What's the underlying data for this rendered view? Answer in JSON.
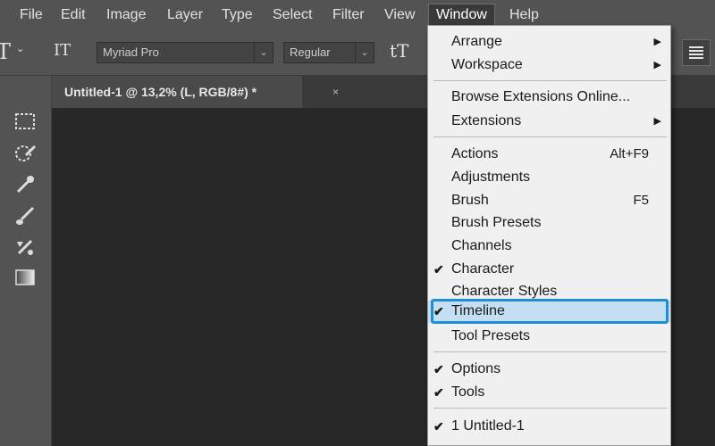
{
  "menubar": {
    "items": [
      "File",
      "Edit",
      "Image",
      "Layer",
      "Type",
      "Select",
      "Filter",
      "View",
      "Window",
      "Help"
    ],
    "active": "Window"
  },
  "optionsbar": {
    "font_family": "Myriad Pro",
    "font_style": "Regular",
    "tool_glyph": "T",
    "orient_glyph": "IT",
    "size_glyph": "tT"
  },
  "document": {
    "tab_title": "Untitled-1 @ 13,2% (L, RGB/8#) *",
    "close_glyph": "×"
  },
  "window_menu": {
    "items": [
      {
        "label": "Arrange",
        "submenu": true
      },
      {
        "label": "Workspace",
        "submenu": true
      },
      {
        "label": "Browse Extensions Online..."
      },
      {
        "label": "Extensions",
        "submenu": true
      },
      {
        "label": "Actions",
        "shortcut": "Alt+F9"
      },
      {
        "label": "Adjustments"
      },
      {
        "label": "Brush",
        "shortcut": "F5"
      },
      {
        "label": "Brush Presets"
      },
      {
        "label": "Channels"
      },
      {
        "label": "Character",
        "checked": true
      },
      {
        "label": "Character Styles"
      },
      {
        "label": "Timeline",
        "checked": true,
        "highlighted": true
      },
      {
        "label": "Tool Presets"
      },
      {
        "label": "Options",
        "checked": true
      },
      {
        "label": "Tools",
        "checked": true
      },
      {
        "label": "1 Untitled-1",
        "checked": true
      }
    ],
    "check_glyph": "✔",
    "arrow_glyph": "▶"
  },
  "colors": {
    "chrome": "#535353",
    "canvas": "#282828",
    "menu_bg": "#f0f0f0",
    "highlight": "#1f8ed8"
  }
}
